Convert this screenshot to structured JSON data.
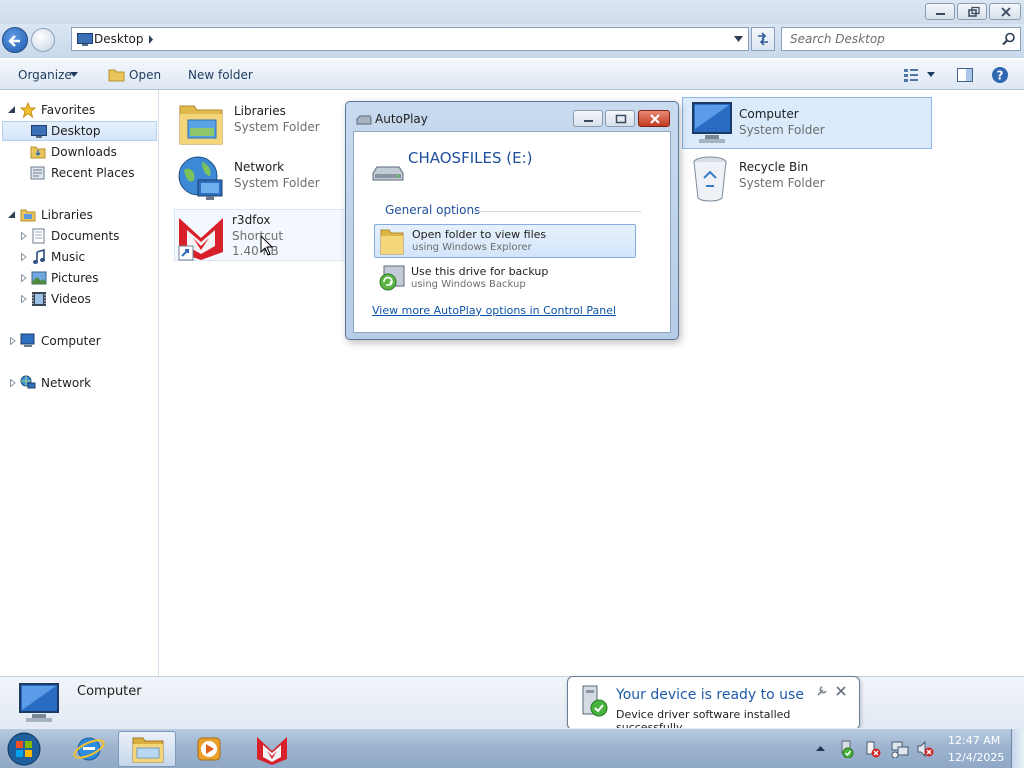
{
  "window": {
    "controls": [
      "minimize",
      "restore",
      "close"
    ]
  },
  "address": {
    "crumb": "Desktop",
    "search_placeholder": "Search Desktop"
  },
  "toolbar": {
    "organize": "Organize",
    "open": "Open",
    "new_folder": "New folder"
  },
  "nav": {
    "favorites": "Favorites",
    "desktop": "Desktop",
    "downloads": "Downloads",
    "recent_places": "Recent Places",
    "libraries": "Libraries",
    "documents": "Documents",
    "music": "Music",
    "pictures": "Pictures",
    "videos": "Videos",
    "computer": "Computer",
    "network": "Network"
  },
  "items": {
    "libraries": {
      "name": "Libraries",
      "type": "System Folder"
    },
    "network": {
      "name": "Network",
      "type": "System Folder"
    },
    "r3dfox": {
      "name": "r3dfox",
      "type": "Shortcut",
      "size": "1.40 KB"
    },
    "computer": {
      "name": "Computer",
      "type": "System Folder"
    },
    "recycle_bin": {
      "name": "Recycle Bin",
      "type": "System Folder"
    }
  },
  "details": {
    "name": "Computer"
  },
  "autoplay": {
    "title": "AutoPlay",
    "drive": "CHAOSFILES (E:)",
    "group": "General options",
    "opt1_title": "Open folder to view files",
    "opt1_sub": "using Windows Explorer",
    "opt2_title": "Use this drive for backup",
    "opt2_sub": "using Windows Backup",
    "link": "View more AutoPlay options in Control Panel"
  },
  "balloon": {
    "title": "Your device is ready to use",
    "body": "Device driver software installed successfully."
  },
  "clock": {
    "time": "12:47 AM",
    "date": "12/4/2025"
  },
  "colors": {
    "link": "#0a54a8",
    "drive_title": "#1e4f9c",
    "balloon_title": "#1e5aa8"
  }
}
